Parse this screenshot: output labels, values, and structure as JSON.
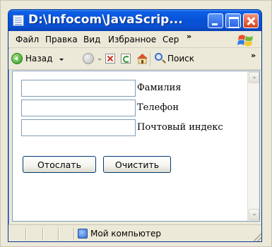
{
  "window": {
    "title": "D:\\Infocom\\JavaScrip..."
  },
  "menubar": {
    "items": [
      {
        "label": "Файл"
      },
      {
        "label": "Правка"
      },
      {
        "label": "Вид"
      },
      {
        "label": "Избранное"
      },
      {
        "label": "Сер"
      }
    ],
    "overflow": "»"
  },
  "toolbar": {
    "back_label": "Назад",
    "search_label": "Поиск",
    "overflow": "»"
  },
  "form": {
    "fields": [
      {
        "label": "Фамилия",
        "value": ""
      },
      {
        "label": "Телефон",
        "value": ""
      },
      {
        "label": "Почтовый индекс",
        "value": ""
      }
    ],
    "submit_label": "Отослать",
    "reset_label": "Очистить"
  },
  "statusbar": {
    "zone": "Мой компьютер"
  },
  "colors": {
    "titlebar": "#0a4fd0",
    "chrome": "#ece9d8",
    "border": "#7f9db9"
  }
}
